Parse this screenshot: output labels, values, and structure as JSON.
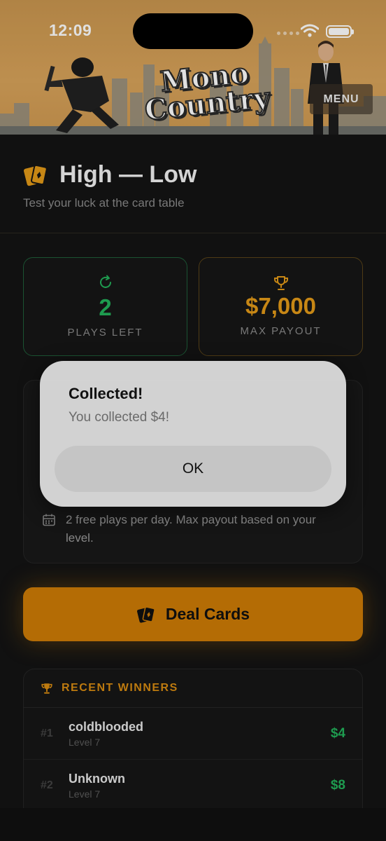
{
  "status_bar": {
    "time": "12:09"
  },
  "header": {
    "logo_line1": "Mono",
    "logo_line2": "Country",
    "menu_label": "MENU"
  },
  "page": {
    "title": "High — Low",
    "subtitle": "Test your luck at the card table"
  },
  "stats": {
    "plays_left": {
      "value": "2",
      "label": "PLAYS LEFT",
      "color": "#23b15a"
    },
    "max_payout": {
      "value": "$7,000",
      "label": "MAX PAYOUT",
      "color": "#e39a18"
    }
  },
  "info": {
    "note": "2 free plays per day. Max payout based on your level."
  },
  "deal_button": {
    "label": "Deal Cards",
    "color": "#cd7b06"
  },
  "recent_winners": {
    "heading": "RECENT WINNERS",
    "rows": [
      {
        "rank": "#1",
        "name": "coldblooded",
        "level": "Level 7",
        "amount": "$4"
      },
      {
        "rank": "#2",
        "name": "Unknown",
        "level": "Level 7",
        "amount": "$8"
      }
    ]
  },
  "alert": {
    "title": "Collected!",
    "message": "You collected $4!",
    "ok_label": "OK"
  },
  "icons": {
    "title_icon": "playing-cards-icon",
    "plays_icon": "refresh-icon",
    "payout_icon": "trophy-icon",
    "info_icon": "calendar-icon",
    "deal_icon": "playing-cards-icon",
    "winners_icon": "trophy-icon"
  }
}
